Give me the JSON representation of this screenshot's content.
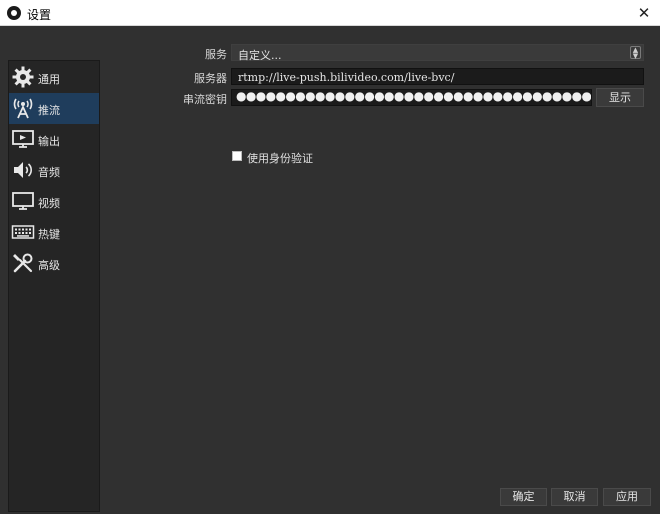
{
  "window": {
    "title": "设置"
  },
  "sidebar": {
    "items": [
      {
        "label": "通用",
        "icon": "gear-icon"
      },
      {
        "label": "推流",
        "icon": "antenna-icon"
      },
      {
        "label": "输出",
        "icon": "output-monitor-icon"
      },
      {
        "label": "音频",
        "icon": "speaker-icon"
      },
      {
        "label": "视频",
        "icon": "monitor-icon"
      },
      {
        "label": "热键",
        "icon": "keyboard-icon"
      },
      {
        "label": "高级",
        "icon": "tools-icon"
      }
    ],
    "active_index": 1,
    "active_color": "#1f3d5c"
  },
  "stream": {
    "service_label": "服务",
    "service_value": "自定义...",
    "server_label": "服务器",
    "server_value": "rtmp://live-push.bilivideo.com/live-bvc/",
    "key_label": "串流密钥",
    "key_value": "●●●●●●●●●●●●●●●●●●●●●●●●●●●●●●●●●●●●●●●●●●●●●●●●●●●●●●",
    "show_button": "显示",
    "auth_checkbox_label": "使用身份验证",
    "auth_checked": false
  },
  "footer": {
    "ok": "确定",
    "cancel": "取消",
    "apply": "应用"
  }
}
